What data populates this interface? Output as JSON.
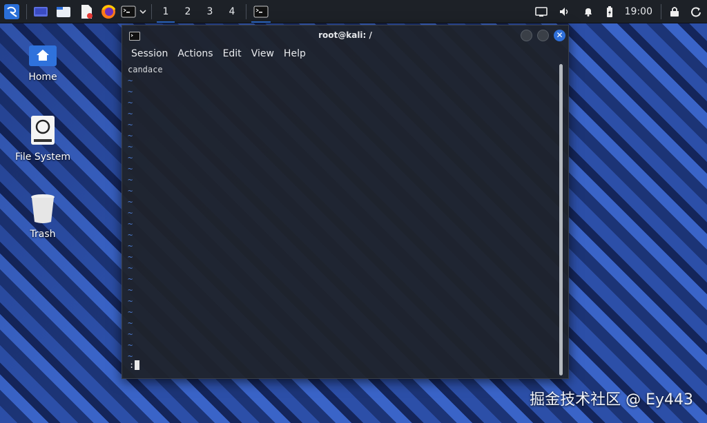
{
  "taskbar": {
    "workspaces": [
      "1",
      "2",
      "3",
      "4"
    ],
    "clock": "19:00",
    "accent": "#2e6fd6"
  },
  "desktop": {
    "icons": [
      {
        "label": "Home",
        "icon": "home-folder-icon"
      },
      {
        "label": "File System",
        "icon": "drive-icon"
      },
      {
        "label": "Trash",
        "icon": "trash-icon"
      }
    ]
  },
  "terminal": {
    "title": "root@kali: /",
    "menu": [
      "Session",
      "Actions",
      "Edit",
      "View",
      "Help"
    ],
    "first_line": "candace",
    "tilde": "~",
    "tilde_count": 26,
    "prompt": ":"
  },
  "watermark": "掘金技术社区 @ Ey443"
}
